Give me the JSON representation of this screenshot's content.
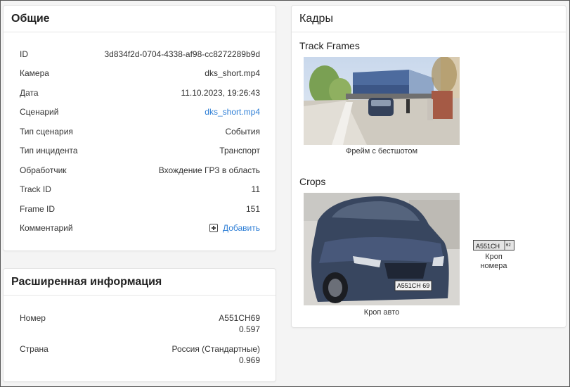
{
  "general": {
    "title": "Общие",
    "rows": [
      {
        "key": "ID",
        "value": "3d834f2d-0704-4338-af98-cc8272289b9d"
      },
      {
        "key": "Камера",
        "value": "dks_short.mp4"
      },
      {
        "key": "Дата",
        "value": "11.10.2023, 19:26:43"
      },
      {
        "key": "Сценарий",
        "value": "dks_short.mp4"
      },
      {
        "key": "Тип сценария",
        "value": "События"
      },
      {
        "key": "Тип инцидента",
        "value": "Транспорт"
      },
      {
        "key": "Обработчик",
        "value": "Вхождение ГРЗ в область"
      },
      {
        "key": "Track ID",
        "value": "11"
      },
      {
        "key": "Frame ID",
        "value": "151"
      },
      {
        "key": "Комментарий",
        "value": "Добавить"
      }
    ]
  },
  "extended": {
    "title": "Расширенная информация",
    "rows": [
      {
        "key": "Номер",
        "value": "А551СН69",
        "score": "0.597"
      },
      {
        "key": "Страна",
        "value": "Россия (Стандартные)",
        "score": "0.969"
      }
    ]
  },
  "frames": {
    "title": "Кадры",
    "track_frames_title": "Track Frames",
    "best_shot_caption": "Фрейм с бестшотом",
    "crops_title": "Crops",
    "car_crop_caption": "Кроп авто",
    "plate_crop_caption_line1": "Кроп",
    "plate_crop_caption_line2": "номера",
    "plate_text": "А551СН 69",
    "plate_text_small": "А551СН",
    "plate_region_small": "62"
  },
  "colors": {
    "link": "#2f7fd6",
    "border": "#e2e2e2"
  }
}
